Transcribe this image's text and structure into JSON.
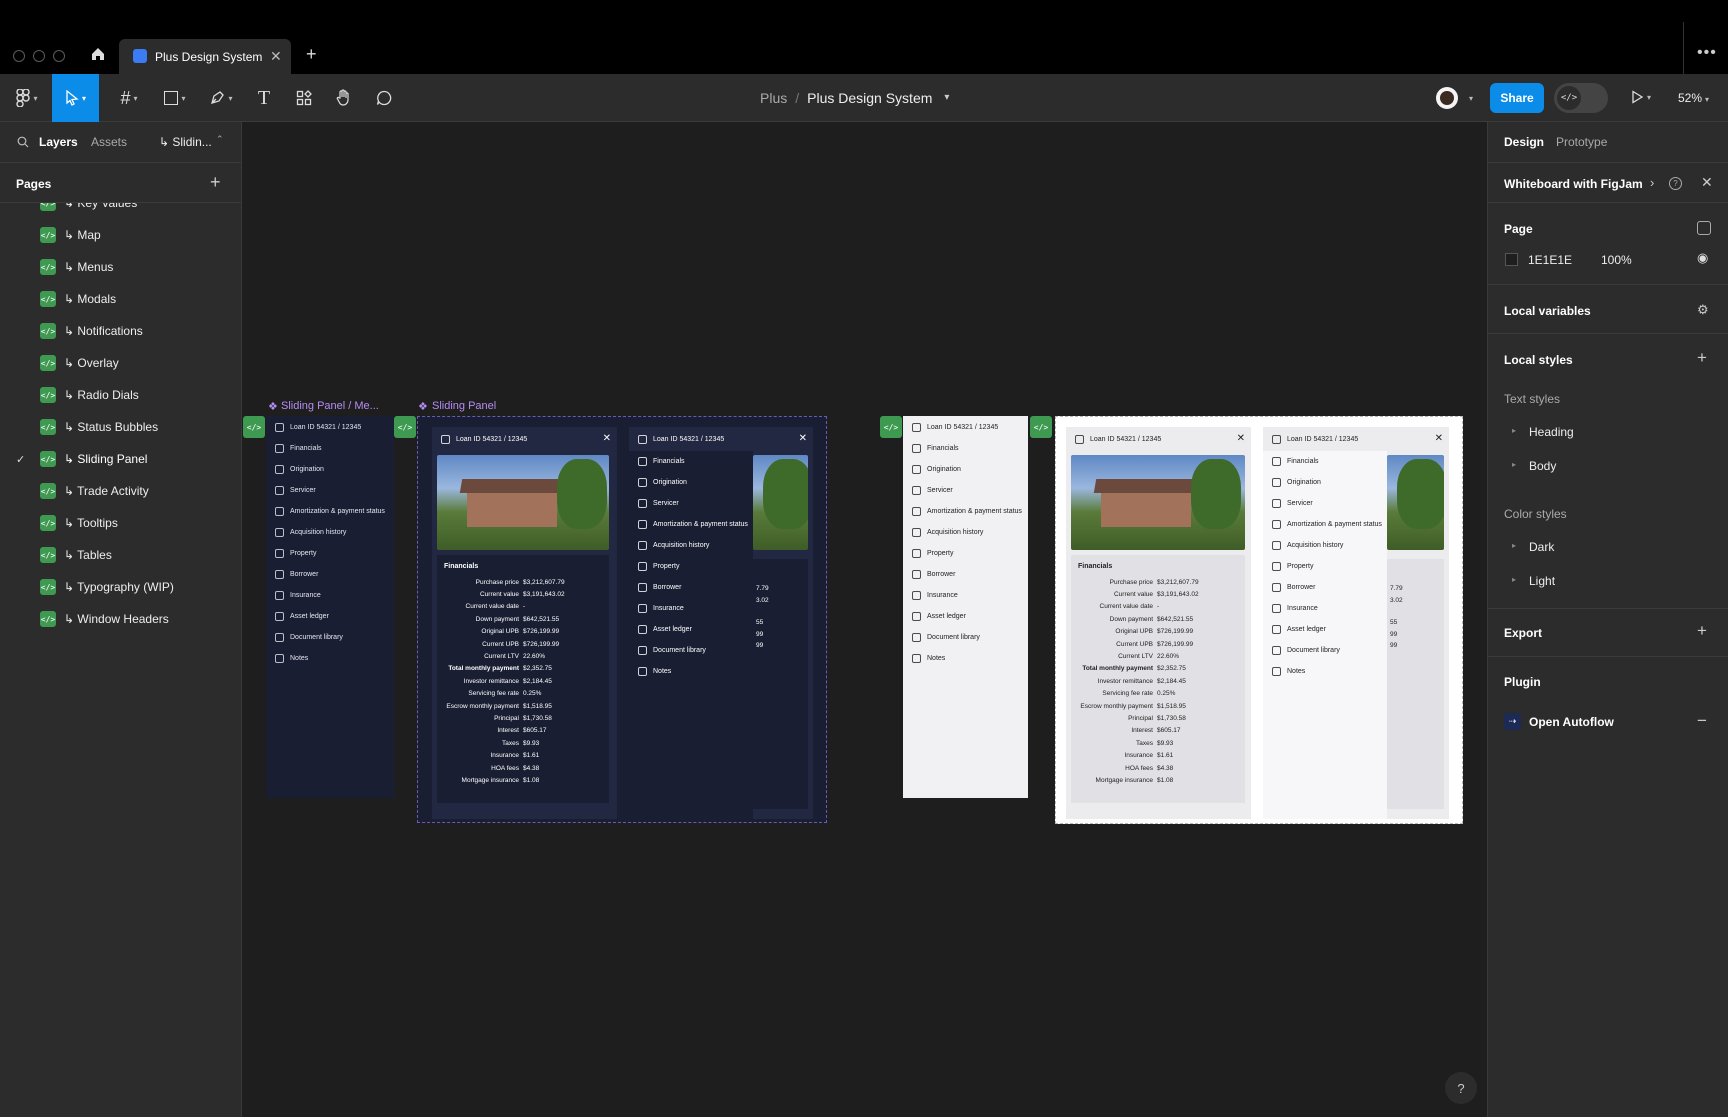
{
  "tab": {
    "title": "Plus Design System"
  },
  "breadcrumb": {
    "project": "Plus",
    "separator": "/",
    "file": "Plus Design System"
  },
  "toolbar": {
    "share_label": "Share",
    "zoom": "52%"
  },
  "left": {
    "tabs": [
      "Layers",
      "Assets"
    ],
    "current_page": "↳ Slidin...",
    "pages_label": "Pages",
    "pages": [
      {
        "label": "↳ Key Values",
        "checked": false
      },
      {
        "label": "↳ Map",
        "checked": false
      },
      {
        "label": "↳ Menus",
        "checked": false
      },
      {
        "label": "↳ Modals",
        "checked": false
      },
      {
        "label": "↳ Notifications",
        "checked": false
      },
      {
        "label": "↳ Overlay",
        "checked": false
      },
      {
        "label": "↳ Radio Dials",
        "checked": false
      },
      {
        "label": "↳ Status Bubbles",
        "checked": false
      },
      {
        "label": "↳ Sliding Panel",
        "checked": true
      },
      {
        "label": "↳ Trade Activity",
        "checked": false
      },
      {
        "label": "↳ Tooltips",
        "checked": false
      },
      {
        "label": "↳ Tables",
        "checked": false
      },
      {
        "label": "↳ Typography (WIP)",
        "checked": false
      },
      {
        "label": "↳ Window Headers",
        "checked": false
      }
    ]
  },
  "right": {
    "tabs": [
      "Design",
      "Prototype"
    ],
    "banner": "Whiteboard with FigJam",
    "page_label": "Page",
    "page_color": "1E1E1E",
    "page_opacity": "100%",
    "local_variables": "Local variables",
    "local_styles": "Local styles",
    "text_styles_label": "Text styles",
    "text_styles": [
      "Heading",
      "Body"
    ],
    "color_styles_label": "Color styles",
    "color_styles": [
      "Dark",
      "Light"
    ],
    "export_label": "Export",
    "plugin_label": "Plugin",
    "plugin_name": "Open Autoflow"
  },
  "canvas": {
    "frame1_label": "Sliding Panel / Me...",
    "frame2_label": "Sliding Panel",
    "loan_id": "Loan ID 54321 / 12345",
    "nav": [
      "Financials",
      "Origination",
      "Servicer",
      "Amortization & payment status",
      "Acquisition history",
      "Property",
      "Borrower",
      "Insurance",
      "Asset ledger",
      "Document library",
      "Notes"
    ],
    "financials_title": "Financials",
    "financials": [
      {
        "k": "Purchase price",
        "v": "$3,212,607.79",
        "b": false
      },
      {
        "k": "Current value",
        "v": "$3,191,643.02",
        "b": false
      },
      {
        "k": "Current value date",
        "v": "-",
        "b": false
      },
      {
        "k": "Down payment",
        "v": "$642,521.55",
        "b": false
      },
      {
        "k": "Original UPB",
        "v": "$726,199.99",
        "b": false
      },
      {
        "k": "Current UPB",
        "v": "$726,199.99",
        "b": false
      },
      {
        "k": "Current LTV",
        "v": "22.60%",
        "b": false
      },
      {
        "k": "Total monthly payment",
        "v": "$2,352.75",
        "b": true
      },
      {
        "k": "Investor remittance",
        "v": "$2,184.45",
        "b": false
      },
      {
        "k": "Servicing fee rate",
        "v": "0.25%",
        "b": false
      },
      {
        "k": "Escrow monthly payment",
        "v": "$1,518.95",
        "b": false
      },
      {
        "k": "Principal",
        "v": "$1,730.58",
        "b": false
      },
      {
        "k": "Interest",
        "v": "$605.17",
        "b": false
      },
      {
        "k": "Taxes",
        "v": "$9.93",
        "b": false
      },
      {
        "k": "Insurance",
        "v": "$1.61",
        "b": false
      },
      {
        "k": "HOA fees",
        "v": "$4.38",
        "b": false
      },
      {
        "k": "Mortgage insurance",
        "v": "$1.08",
        "b": false
      }
    ],
    "partial_values": [
      "7.79",
      "3.02",
      "55",
      "99",
      "99"
    ]
  }
}
